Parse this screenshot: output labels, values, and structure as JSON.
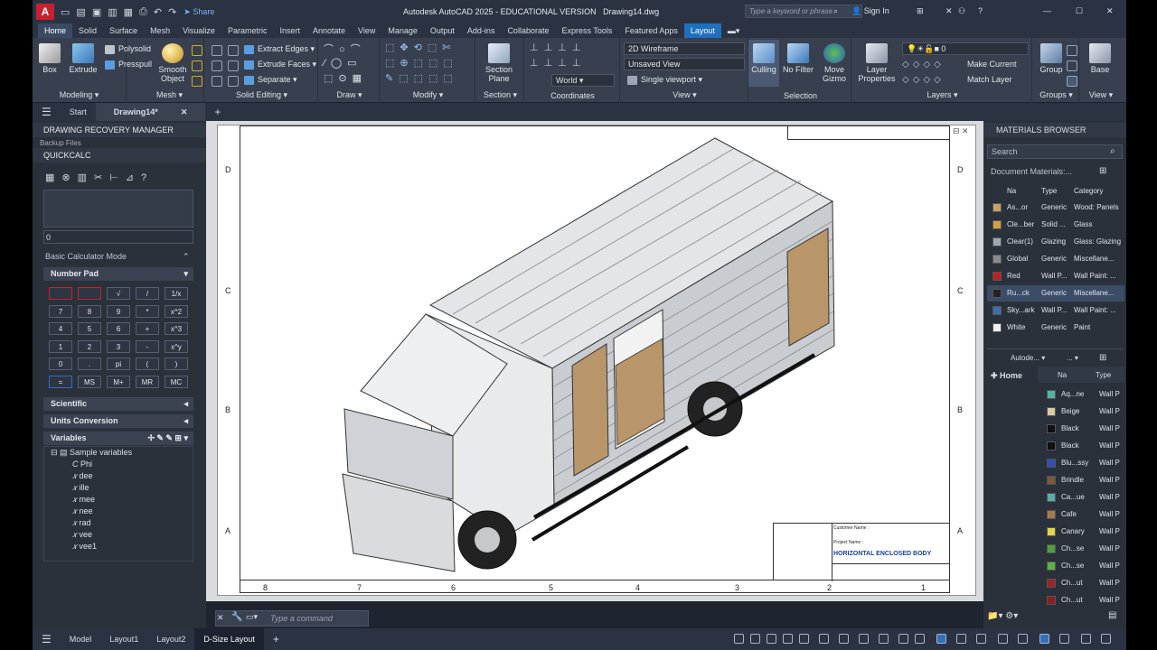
{
  "app": {
    "logo": "A",
    "title": "Autodesk AutoCAD 2025 - EDUCATIONAL VERSION",
    "file": "Drawing14.dwg",
    "share": "Share",
    "search_placeholder": "Type a keyword or phrase",
    "sign_in": "Sign In"
  },
  "ribbon_tabs": [
    "Home",
    "Solid",
    "Surface",
    "Mesh",
    "Visualize",
    "Parametric",
    "Insert",
    "Annotate",
    "View",
    "Manage",
    "Output",
    "Add-ins",
    "Collaborate",
    "Express Tools",
    "Featured Apps",
    "Layout"
  ],
  "panels": {
    "modeling": {
      "label": "Modeling",
      "box": "Box",
      "extrude": "Extrude",
      "polysolid": "Polysolid",
      "presspull": "Presspull"
    },
    "mesh": {
      "label": "Mesh",
      "smooth": "Smooth\nObject"
    },
    "solid_editing": {
      "label": "Solid Editing",
      "extract": "Extract Edges",
      "extrude_faces": "Extrude Faces",
      "separate": "Separate"
    },
    "draw": {
      "label": "Draw"
    },
    "modify": {
      "label": "Modify"
    },
    "section": {
      "label": "Section",
      "plane": "Section\nPlane"
    },
    "coordinates": {
      "label": "Coordinates",
      "world": "World"
    },
    "view": {
      "label": "View",
      "visual_style": "2D Wireframe",
      "saved_view": "Unsaved View",
      "viewport": "Single viewport"
    },
    "selection": {
      "label": "Selection",
      "culling": "Culling",
      "no_filter": "No Filter",
      "move_gizmo": "Move\nGizmo"
    },
    "layers": {
      "label": "Layers",
      "layer_props": "Layer\nProperties",
      "layer_name": "0",
      "make_current": "Make Current",
      "match_layer": "Match Layer"
    },
    "groups": {
      "label": "Groups",
      "group": "Group"
    },
    "view2": {
      "label": "View",
      "base": "Base"
    }
  },
  "file_tabs": {
    "start": "Start",
    "drawing": "Drawing14*"
  },
  "left": {
    "recovery": "DRAWING RECOVERY MANAGER",
    "backup": "Backup Files",
    "quickcalc": "QUICKCALC",
    "display_value": "0",
    "mode": "Basic Calculator Mode",
    "numpad": "Number Pad",
    "keys": [
      "",
      "",
      "√",
      "/",
      "1/x",
      "7",
      "8",
      "9",
      "*",
      "x^2",
      "4",
      "5",
      "6",
      "+",
      "x^3",
      "1",
      "2",
      "3",
      "-",
      "x^y",
      "0",
      ".",
      "pi",
      "(",
      ")",
      "=",
      "MS",
      "M+",
      "MR",
      "MC"
    ],
    "scientific": "Scientific",
    "units": "Units Conversion",
    "variables": "Variables",
    "sample": "Sample variables",
    "vars": [
      "Phi",
      "dee",
      "ille",
      "mee",
      "nee",
      "rad",
      "vee",
      "vee1"
    ]
  },
  "drawing": {
    "row_labels": [
      "D",
      "C",
      "B",
      "A"
    ],
    "col_labels": [
      "8",
      "7",
      "6",
      "5",
      "4",
      "3",
      "2",
      "1"
    ],
    "customer": "Customer Name :",
    "project": "Project Name :",
    "title": "HORIZONTAL ENCLOSED BODY"
  },
  "command": {
    "placeholder": "Type a command"
  },
  "right": {
    "header": "MATERIALS BROWSER",
    "search": "Search",
    "doc_materials": "Document Materials:...",
    "cols": [
      "Na",
      "Type",
      "Category"
    ],
    "materials": [
      {
        "name": "As...or",
        "type": "Generic",
        "cat": "Wood: Panels",
        "color": "#c8a06a"
      },
      {
        "name": "Cle...ber",
        "type": "Solid ...",
        "cat": "Glass",
        "color": "#d6a23c"
      },
      {
        "name": "Clear(1)",
        "type": "Glazing",
        "cat": "Glass: Glazing",
        "color": "#9ea7b3"
      },
      {
        "name": "Global",
        "type": "Generic",
        "cat": "Miscellane...",
        "color": "#8a8a8a"
      },
      {
        "name": "Red",
        "type": "Wall P...",
        "cat": "Wall Paint: ...",
        "color": "#c41f1f"
      },
      {
        "name": "Ru...ck",
        "type": "Generic",
        "cat": "Miscellane...",
        "color": "#222"
      },
      {
        "name": "Sky...ark",
        "type": "Wall P...",
        "cat": "Wall Paint: ...",
        "color": "#3d6fb0"
      },
      {
        "name": "White",
        "type": "Generic",
        "cat": "Paint",
        "color": "#f0f0f0"
      }
    ],
    "library": "Autode...",
    "home": "Home",
    "lib_cols": [
      "Na",
      "Type"
    ],
    "lib_items": [
      {
        "name": "Aq...ne",
        "type": "Wall P",
        "color": "#4fb4a6"
      },
      {
        "name": "Beige",
        "type": "Wall P",
        "color": "#d7c9a1"
      },
      {
        "name": "Black",
        "type": "Wall P",
        "color": "#111"
      },
      {
        "name": "Black",
        "type": "Wall P",
        "color": "#111"
      },
      {
        "name": "Blu...ssy",
        "type": "Wall P",
        "color": "#2f4fbf"
      },
      {
        "name": "Brindle",
        "type": "Wall P",
        "color": "#7b5a3b"
      },
      {
        "name": "Ca...ue",
        "type": "Wall P",
        "color": "#5aaab2"
      },
      {
        "name": "Cafe",
        "type": "Wall P",
        "color": "#a37c4e"
      },
      {
        "name": "Canary",
        "type": "Wall P",
        "color": "#e6d34a"
      },
      {
        "name": "Ch...se",
        "type": "Wall P",
        "color": "#4ea23c"
      },
      {
        "name": "Ch...se",
        "type": "Wall P",
        "color": "#5bb545"
      },
      {
        "name": "Ch...ut",
        "type": "Wall P",
        "color": "#a31f2a"
      },
      {
        "name": "Ch...ut",
        "type": "Wall P",
        "color": "#8c1e24"
      }
    ]
  },
  "status": {
    "model": "Model",
    "layout1": "Layout1",
    "layout2": "Layout2",
    "dsize": "D-Size Layout"
  }
}
